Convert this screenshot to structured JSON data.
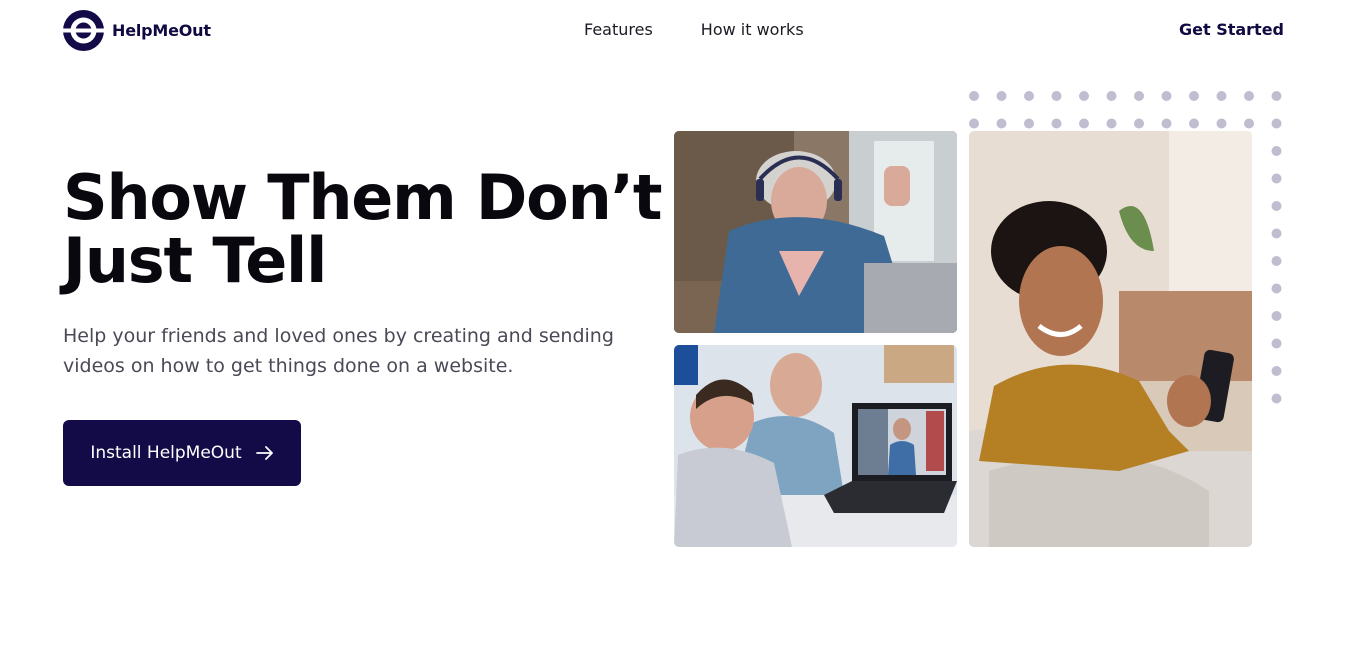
{
  "brand": {
    "name": "HelpMeOut",
    "color": "#120b48"
  },
  "nav": {
    "items": [
      "Features",
      "How it works"
    ]
  },
  "header": {
    "get_started": "Get Started"
  },
  "hero": {
    "title_line1": "Show Them Don’t",
    "title_line2": "Just Tell",
    "subtitle": "Help your friends and loved ones by creating and sending videos on how to get things done on a website.",
    "cta_label": "Install HelpMeOut"
  },
  "images": [
    {
      "name": "woman-with-headphones-laptop-photo"
    },
    {
      "name": "grandfather-and-boy-video-call-photo"
    },
    {
      "name": "woman-smiling-at-phone-photo"
    }
  ],
  "colors": {
    "dots": "#bfbdcf",
    "text": "#08080e",
    "muted": "#4a4a56"
  }
}
